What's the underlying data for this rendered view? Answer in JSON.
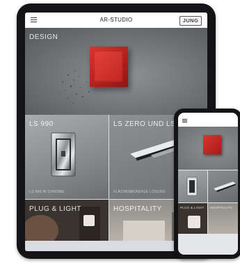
{
  "app": {
    "title": "AR-STUDIO",
    "brand": "JUNG"
  },
  "tablet": {
    "tiles": [
      {
        "label": "DESIGN",
        "sub": ""
      },
      {
        "label": "LS 990",
        "sub": "LS 990 IN CHROME"
      },
      {
        "label": "LS ZERO UND LS CUBE",
        "sub": "FLÄCHENBÜNDIGE LÖSUNG"
      },
      {
        "label": "PLUG & LIGHT",
        "sub": ""
      },
      {
        "label": "HOSPITALITY",
        "sub": ""
      }
    ]
  },
  "phone": {
    "tiles": [
      {
        "label": ""
      },
      {
        "label": ""
      },
      {
        "label": ""
      },
      {
        "label": "PLUG & LIGHT"
      },
      {
        "label": "HOSPITALITY"
      }
    ]
  },
  "colors": {
    "accent_red": "#c42622",
    "device_frame": "#141416",
    "concrete": "#7a7e80"
  }
}
